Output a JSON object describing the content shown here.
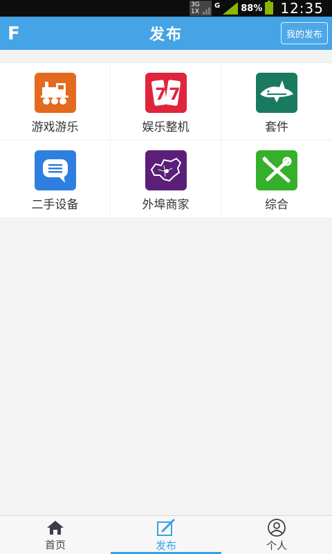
{
  "status_bar": {
    "network_type_top": "3G",
    "network_type_bottom": "1X",
    "data_letter": "G",
    "battery_percent": "88%",
    "time": "12:35"
  },
  "header": {
    "logo_letter": "F",
    "title": "发布",
    "my_posts_label": "我的发布"
  },
  "categories": [
    {
      "label": "游戏游乐",
      "icon": "train-icon",
      "color": "#e36a1e"
    },
    {
      "label": "娱乐整机",
      "icon": "slot-77-icon",
      "color": "#e0243c"
    },
    {
      "label": "套件",
      "icon": "shark-icon",
      "color": "#1a7a5f"
    },
    {
      "label": "二手设备",
      "icon": "chat-bubble-icon",
      "color": "#2f7fe0"
    },
    {
      "label": "外埠商家",
      "icon": "china-map-icon",
      "color": "#5b1f7a"
    },
    {
      "label": "综合",
      "icon": "tools-icon",
      "color": "#36b02a"
    }
  ],
  "tabs": [
    {
      "label": "首页",
      "icon": "home-icon"
    },
    {
      "label": "发布",
      "icon": "edit-icon"
    },
    {
      "label": "个人",
      "icon": "person-icon"
    }
  ],
  "colors": {
    "header_blue": "#44a4e6",
    "active_tab": "#3aa0e4"
  }
}
